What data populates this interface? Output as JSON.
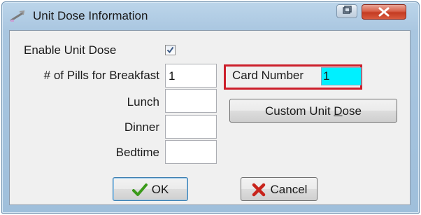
{
  "window": {
    "title": "Unit Dose Information"
  },
  "form": {
    "enable_label": "Enable Unit Dose",
    "enable_checked": true,
    "breakfast_label": "# of Pills for Breakfast",
    "breakfast_value": "1",
    "lunch_label": "Lunch",
    "lunch_value": "",
    "dinner_label": "Dinner",
    "dinner_value": "",
    "bedtime_label": "Bedtime",
    "bedtime_value": "",
    "card_label": "Card Number",
    "card_value": "1"
  },
  "buttons": {
    "custom_prefix": "Custom Unit ",
    "custom_mnemonic": "D",
    "custom_suffix": "ose",
    "ok_label": "OK",
    "cancel_label": "Cancel"
  },
  "icons": {
    "window": "pill-dropper-icon",
    "restore": "restore-icon",
    "close": "close-icon",
    "ok": "checkmark-icon",
    "cancel": "x-icon"
  },
  "colors": {
    "card_field_bg": "#00f0ff",
    "highlight_border": "#cc1f2b",
    "ok_check": "#3a9a1a",
    "cancel_x": "#c8231b"
  }
}
